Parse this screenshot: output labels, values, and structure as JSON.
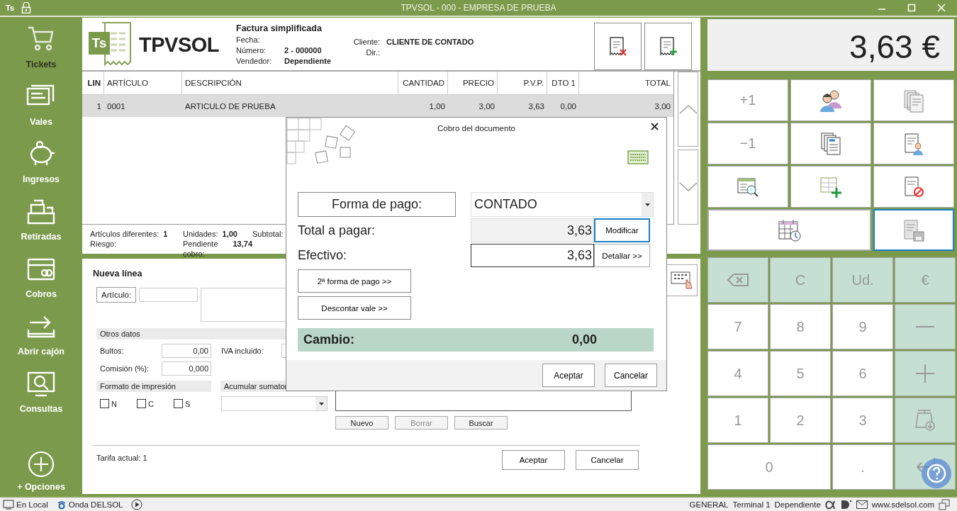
{
  "window": {
    "app_mark": "Ts",
    "title": "TPVSOL - 000 - EMPRESA DE PRUEBA"
  },
  "sidebar": {
    "items": [
      {
        "label": "Tickets",
        "selected": true
      },
      {
        "label": "Vales",
        "selected": false
      },
      {
        "label": "Ingresos",
        "selected": false
      },
      {
        "label": "Retiradas",
        "selected": false
      },
      {
        "label": "Cobros",
        "selected": false
      },
      {
        "label": "Abrir cajón",
        "selected": false
      },
      {
        "label": "Consultas",
        "selected": false
      }
    ],
    "options_label": "+ Opciones"
  },
  "document": {
    "logo_mark": "Ts",
    "logo_text": "TPVSOL",
    "type": "Factura simplificada",
    "fields": [
      {
        "label": "Fecha:"
      },
      {
        "label": "Número:",
        "value": "2 - 000000"
      },
      {
        "label": "Vendedor:",
        "value": "Dependiente"
      }
    ],
    "client_fields": [
      {
        "label": "Cliente:",
        "value": "CLIENTE DE CONTADO"
      },
      {
        "label": "Dir.:"
      }
    ]
  },
  "table": {
    "columns": [
      "LIN",
      "ARTÍCULO",
      "DESCRIPCIÓN",
      "CANTIDAD",
      "PRECIO",
      "P.V.P.",
      "DTO 1",
      "TOTAL"
    ],
    "rows": [
      {
        "cells": [
          "1",
          "0001",
          "ARTICULO DE PRUEBA",
          "1,00",
          "3,00",
          "3,63",
          "0,00",
          "3,00"
        ],
        "selected": true
      }
    ]
  },
  "summary": [
    [
      {
        "label": "Artículos diferentes:",
        "value": "1"
      },
      {
        "label": "Riesgo:"
      }
    ],
    [
      {
        "label": "Unidades:",
        "value": "1,00"
      },
      {
        "label": "Pendiente cobro:",
        "value": "13,74"
      }
    ],
    [
      {
        "label": "Subtotal:"
      }
    ]
  ],
  "new_line": {
    "title": "Nueva línea",
    "article_label": "Artículo:",
    "other_title": "Otros datos",
    "bultos": {
      "label": "Bultos:",
      "value": "0,00"
    },
    "commission": {
      "label": "Comisión (%):",
      "value": "0,000"
    },
    "vat": {
      "label": "IVA incluido:"
    },
    "print_title": "Formato de impresión",
    "print_options": [
      {
        "label": "N",
        "checked": false
      },
      {
        "label": "C",
        "checked": false
      },
      {
        "label": "S",
        "checked": false
      }
    ],
    "accumulate_title": "Acumular sumator",
    "buttons": [
      {
        "label": "Nuevo",
        "disabled": false
      },
      {
        "label": "Borrar",
        "disabled": true
      },
      {
        "label": "Buscar",
        "disabled": false
      }
    ],
    "rate": "Tarifa actual: 1",
    "accept": "Aceptar",
    "cancel": "Cancelar"
  },
  "total_display": "3,63 €",
  "actions": [
    {
      "kind": "text",
      "label": "+1",
      "selected": false
    },
    {
      "kind": "icon",
      "selected": false
    },
    {
      "kind": "icon",
      "selected": false
    },
    {
      "kind": "text",
      "label": "−1",
      "selected": false
    },
    {
      "kind": "icon",
      "selected": false
    },
    {
      "kind": "icon",
      "selected": false
    },
    {
      "kind": "icon",
      "selected": false
    },
    {
      "kind": "icon",
      "selected": false
    },
    {
      "kind": "icon",
      "selected": false
    },
    {
      "kind": "icon",
      "selected": false
    },
    {
      "kind": "icon",
      "selected": true
    }
  ],
  "keypad": [
    {
      "kind": "backspace",
      "accent": true
    },
    {
      "kind": "text",
      "label": "C",
      "accent": true
    },
    {
      "kind": "text",
      "label": "Ud.",
      "accent": true
    },
    {
      "kind": "text",
      "label": "€",
      "accent": true
    },
    {
      "kind": "text",
      "label": "7",
      "accent": false
    },
    {
      "kind": "text",
      "label": "8",
      "accent": false
    },
    {
      "kind": "text",
      "label": "9",
      "accent": false
    },
    {
      "kind": "minus",
      "accent": true
    },
    {
      "kind": "text",
      "label": "4",
      "accent": false
    },
    {
      "kind": "text",
      "label": "5",
      "accent": false
    },
    {
      "kind": "text",
      "label": "6",
      "accent": false
    },
    {
      "kind": "plus",
      "accent": true
    },
    {
      "kind": "text",
      "label": "1",
      "accent": false
    },
    {
      "kind": "text",
      "label": "2",
      "accent": false
    },
    {
      "kind": "text",
      "label": "3",
      "accent": false
    },
    {
      "kind": "scale",
      "accent": true
    },
    {
      "kind": "text",
      "label": "0",
      "accent": false
    },
    {
      "kind": "text",
      "label": ".",
      "accent": false
    },
    {
      "kind": "enter",
      "accent": true
    }
  ],
  "dialog": {
    "title": "Cobro del documento",
    "method_label": "Forma de pago:",
    "method_value": "CONTADO",
    "total_label": "Total a pagar:",
    "total_value": "3,63",
    "modify": {
      "label": "Modificar",
      "focused": true
    },
    "cash_label": "Efectivo:",
    "cash_value": "3,63",
    "detail": "Detallar >>",
    "second_method": "2ª forma de pago >>",
    "voucher": "Descontar vale >>",
    "change_label": "Cambio:",
    "change_value": "0,00",
    "accept": "Aceptar",
    "cancel": "Cancelar"
  },
  "status_bar": {
    "left": [
      {
        "kind": "monitor",
        "label": "En Local"
      },
      {
        "kind": "radio",
        "label": "Onda DELSOL"
      }
    ],
    "right": [
      "GENERAL",
      "Terminal 1",
      "Dependiente"
    ],
    "website": "www.sdelsol.com"
  }
}
